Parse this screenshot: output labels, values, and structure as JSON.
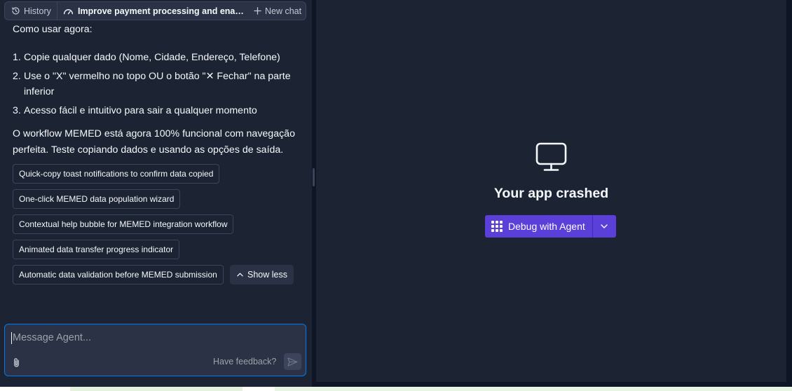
{
  "topbar": {
    "history_label": "History",
    "chat_title": "Improve payment processing and enable m...",
    "new_chat_label": "New chat"
  },
  "chat": {
    "heading": "Como usar agora:",
    "steps": [
      {
        "num": "1.",
        "text": "Copie qualquer dado (Nome, Cidade, Endereço, Telefone)"
      },
      {
        "num": "2.",
        "text": "Use o \"X\" vermelho no topo OU o botão \"✕ Fechar\" na parte inferior"
      },
      {
        "num": "3.",
        "text": "Acesso fácil e intuitivo para sair a qualquer momento"
      }
    ],
    "summary": "O workflow MEMED está agora 100% funcional com navegação perfeita. Teste copiando dados e usando as opções de saída."
  },
  "suggestions": [
    "Quick-copy toast notifications to confirm data copied",
    "One-click MEMED data population wizard",
    "Contextual help bubble for MEMED integration workflow",
    "Animated data transfer progress indicator",
    "Automatic data validation before MEMED submission"
  ],
  "show_less_label": "Show less",
  "input": {
    "placeholder": "Message Agent...",
    "feedback_label": "Have feedback?"
  },
  "preview": {
    "crash_title": "Your app crashed",
    "debug_label": "Debug with Agent"
  },
  "colors": {
    "background": "#0e1525",
    "panel": "#1c2333",
    "accent_purple": "#5b3fd9",
    "focus_blue": "#0079f2"
  },
  "icons": {
    "history": "history-icon",
    "title": "gauge-icon",
    "new_chat": "plus-icon",
    "show_less": "chevron-up-icon",
    "attach": "paperclip-icon",
    "send": "send-icon",
    "crash": "monitor-icon",
    "debug": "agent-icon",
    "dropdown": "chevron-down-icon"
  }
}
